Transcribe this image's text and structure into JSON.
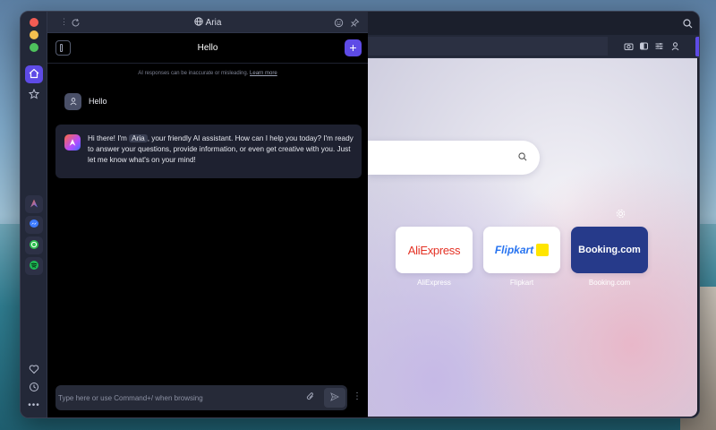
{
  "aria_panel": {
    "top_title": "Aria",
    "chat_title": "Hello",
    "new_chat_label": "+",
    "disclaimer_text": "AI responses can be inaccurate or misleading.",
    "disclaimer_link": "Learn more",
    "user_message": "Hello",
    "assistant_before": "Hi there! I'm",
    "assistant_name": "Aria",
    "assistant_after": ", your friendly AI assistant. How can I help you today? I'm ready to answer your questions, provide information, or even get creative with you. Just let me know what's on your mind!",
    "input_placeholder": "Type here or use Command+/ when browsing"
  },
  "speed_dial": [
    {
      "name": "AliExpress",
      "label": "AliExpress",
      "bg": "#ffffff"
    },
    {
      "name": "Flipkart",
      "label": "Flipkart",
      "bg": "#ffffff"
    },
    {
      "name": "Booking.com",
      "label": "Booking.com",
      "bg": "#263a8a"
    }
  ],
  "sidebar": {
    "items": [
      {
        "icon": "home-icon",
        "active": true
      },
      {
        "icon": "star-icon",
        "active": false
      },
      {
        "icon": "aria-icon",
        "active": false
      },
      {
        "icon": "messenger-icon",
        "active": false
      },
      {
        "icon": "whatsapp-icon",
        "active": false
      },
      {
        "icon": "spotify-icon",
        "active": false
      },
      {
        "icon": "heart-icon",
        "active": false
      },
      {
        "icon": "history-icon",
        "active": false
      },
      {
        "icon": "more-icon",
        "active": false
      }
    ]
  },
  "colors": {
    "accent": "#5e4be6",
    "panel_bg": "#000000",
    "card_bg": "#1e2130"
  }
}
